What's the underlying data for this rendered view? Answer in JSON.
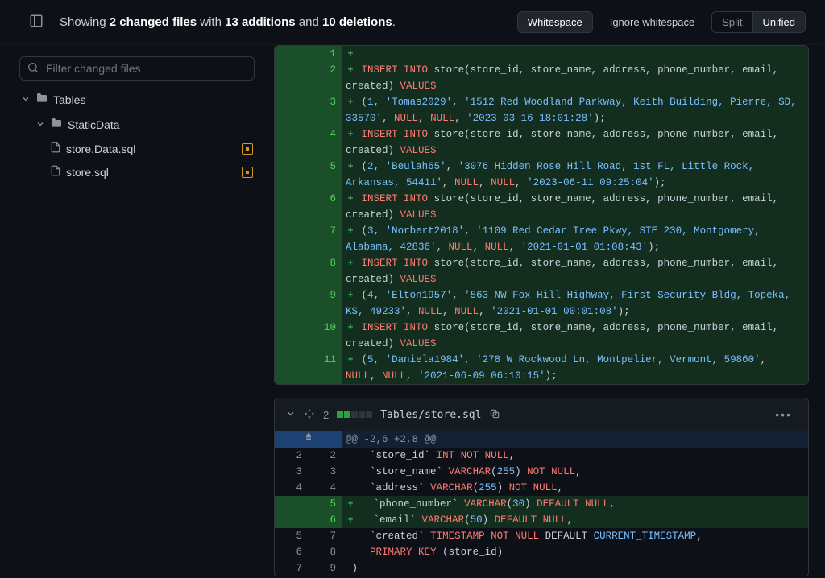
{
  "header": {
    "summary_pre": "Showing ",
    "files_count": "2 changed files",
    "summary_mid": " with ",
    "additions": "13 additions",
    "summary_and": " and ",
    "deletions": "10 deletions",
    "summary_end": ".",
    "btn_whitespace": "Whitespace",
    "btn_ignore_whitespace": "Ignore whitespace",
    "btn_split": "Split",
    "btn_unified": "Unified"
  },
  "sidebar": {
    "filter_placeholder": "Filter changed files",
    "tree": {
      "folder1": "Tables",
      "folder2": "StaticData",
      "file1": "store.Data.sql",
      "file2": "store.sql"
    }
  },
  "file2": {
    "change_count": "2",
    "name": "Tables/store.sql",
    "hunk": "@@ -2,6 +2,8 @@"
  },
  "diff1_lines": [
    {
      "old": "",
      "new": "1",
      "m": "+",
      "html": ""
    },
    {
      "old": "",
      "new": "2",
      "m": "+",
      "html": "<span class='k1'>INSERT</span> <span class='k1'>INTO</span> <span class='plain'>store(store_id, store_name, address, phone_number, email, created)</span> <span class='k1'>VALUES</span>"
    },
    {
      "old": "",
      "new": "3",
      "m": "+",
      "html": "<span class='plain'>(</span><span class='num'>1</span><span class='plain'>, </span><span class='str'>'Tomas2029'</span><span class='plain'>, </span><span class='str'>'1512 Red Woodland Parkway, Keith Building, Pierre, SD, 33570'</span><span class='plain'>, </span><span class='k1'>NULL</span><span class='plain'>, </span><span class='k1'>NULL</span><span class='plain'>, </span><span class='str'>'2023-03-16 18:01:28'</span><span class='plain'>);</span>"
    },
    {
      "old": "",
      "new": "4",
      "m": "+",
      "html": "<span class='k1'>INSERT</span> <span class='k1'>INTO</span> <span class='plain'>store(store_id, store_name, address, phone_number, email, created)</span> <span class='k1'>VALUES</span>"
    },
    {
      "old": "",
      "new": "5",
      "m": "+",
      "html": "<span class='plain'>(</span><span class='num'>2</span><span class='plain'>, </span><span class='str'>'Beulah65'</span><span class='plain'>, </span><span class='str'>'3076 Hidden Rose Hill Road, 1st FL, Little Rock, Arkansas, 54411'</span><span class='plain'>, </span><span class='k1'>NULL</span><span class='plain'>, </span><span class='k1'>NULL</span><span class='plain'>, </span><span class='str'>'2023-06-11 09:25:04'</span><span class='plain'>);</span>"
    },
    {
      "old": "",
      "new": "6",
      "m": "+",
      "html": "<span class='k1'>INSERT</span> <span class='k1'>INTO</span> <span class='plain'>store(store_id, store_name, address, phone_number, email, created)</span> <span class='k1'>VALUES</span>"
    },
    {
      "old": "",
      "new": "7",
      "m": "+",
      "html": "<span class='plain'>(</span><span class='num'>3</span><span class='plain'>, </span><span class='str'>'Norbert2018'</span><span class='plain'>, </span><span class='str'>'1109 Red Cedar Tree Pkwy, STE 230, Montgomery, Alabama, 42836'</span><span class='plain'>, </span><span class='k1'>NULL</span><span class='plain'>, </span><span class='k1'>NULL</span><span class='plain'>, </span><span class='str'>'2021-01-01 01:08:43'</span><span class='plain'>);</span>"
    },
    {
      "old": "",
      "new": "8",
      "m": "+",
      "html": "<span class='k1'>INSERT</span> <span class='k1'>INTO</span> <span class='plain'>store(store_id, store_name, address, phone_number, email, created)</span> <span class='k1'>VALUES</span>"
    },
    {
      "old": "",
      "new": "9",
      "m": "+",
      "html": "<span class='plain'>(</span><span class='num'>4</span><span class='plain'>, </span><span class='str'>'Elton1957'</span><span class='plain'>, </span><span class='str'>'563 NW Fox Hill Highway, First Security Bldg, Topeka, KS, 49233'</span><span class='plain'>, </span><span class='k1'>NULL</span><span class='plain'>, </span><span class='k1'>NULL</span><span class='plain'>, </span><span class='str'>'2021-01-01 00:01:08'</span><span class='plain'>);</span>"
    },
    {
      "old": "",
      "new": "10",
      "m": "+",
      "html": "<span class='k1'>INSERT</span> <span class='k1'>INTO</span> <span class='plain'>store(store_id, store_name, address, phone_number, email, created)</span> <span class='k1'>VALUES</span>"
    },
    {
      "old": "",
      "new": "11",
      "m": "+",
      "html": "<span class='plain'>(</span><span class='num'>5</span><span class='plain'>, </span><span class='str'>'Daniela1984'</span><span class='plain'>, </span><span class='str'>'278 W Rockwood Ln, Montpelier, Vermont, 59860'</span><span class='plain'>, </span><span class='k1'>NULL</span><span class='plain'>, </span><span class='k1'>NULL</span><span class='plain'>, </span><span class='str'>'2021-06-09 06:10:15'</span><span class='plain'>);</span>"
    }
  ],
  "diff2_lines": [
    {
      "type": "hunk",
      "html": "@@ -2,6 +2,8 @@"
    },
    {
      "type": "ctx",
      "old": "2",
      "new": "2",
      "html": "   <span class='plain'>`store_id`</span> <span class='k1'>INT NOT NULL</span><span class='plain'>,</span>"
    },
    {
      "type": "ctx",
      "old": "3",
      "new": "3",
      "html": "   <span class='plain'>`store_name`</span> <span class='k1'>VARCHAR</span><span class='plain'>(</span><span class='num'>255</span><span class='plain'>)</span> <span class='k1'>NOT NULL</span><span class='plain'>,</span>"
    },
    {
      "type": "ctx",
      "old": "4",
      "new": "4",
      "html": "   <span class='plain'>`address`</span> <span class='k1'>VARCHAR</span><span class='plain'>(</span><span class='num'>255</span><span class='plain'>)</span> <span class='k1'>NOT NULL</span><span class='plain'>,</span>"
    },
    {
      "type": "add",
      "old": "",
      "new": "5",
      "html": "   <span class='plain'>`phone_number`</span> <span class='k1'>VARCHAR</span><span class='plain'>(</span><span class='num'>30</span><span class='plain'>)</span> <span class='k1'>DEFAULT</span> <span class='k1'>NULL</span><span class='plain'>,</span>"
    },
    {
      "type": "add",
      "old": "",
      "new": "6",
      "html": "   <span class='plain'>`email`</span> <span class='k1'>VARCHAR</span><span class='plain'>(</span><span class='num'>50</span><span class='plain'>)</span> <span class='k1'>DEFAULT</span> <span class='k1'>NULL</span><span class='plain'>,</span>"
    },
    {
      "type": "ctx",
      "old": "5",
      "new": "7",
      "html": "   <span class='plain'>`created`</span> <span class='k1'>TIMESTAMP</span> <span class='k1'>NOT NULL</span> <span class='plain'>DEFAULT</span> <span class='curr'>CURRENT_TIMESTAMP</span><span class='plain'>,</span>"
    },
    {
      "type": "ctx",
      "old": "6",
      "new": "8",
      "html": "   <span class='k1'>PRIMARY KEY</span> <span class='plain'>(store_id)</span>"
    },
    {
      "type": "ctx",
      "old": "7",
      "new": "9",
      "html": "<span class='plain'>)</span>"
    }
  ]
}
